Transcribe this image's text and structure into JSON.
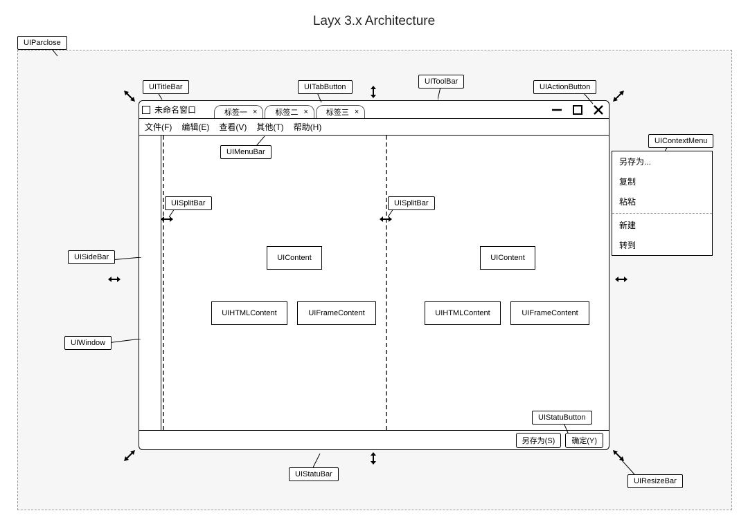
{
  "title": "Layx 3.x Architecture",
  "window_title": "未命名窗口",
  "tabs": [
    "标签一",
    "标签二",
    "标签三"
  ],
  "menu": [
    "文件(F)",
    "编辑(E)",
    "查看(V)",
    "其他(T)",
    "帮助(H)"
  ],
  "status_buttons": [
    "另存为(S)",
    "确定(Y)"
  ],
  "context_menu": {
    "group1": [
      "另存为...",
      "复制",
      "粘粘"
    ],
    "group2": [
      "新建",
      "转到"
    ]
  },
  "tree": {
    "root": "UIContent",
    "left": "UIHTMLContent",
    "right": "UIFrameContent"
  },
  "callouts": {
    "parclose": "UIParclose",
    "titlebar": "UITitleBar",
    "tabbutton": "UITabButton",
    "toolbar": "UIToolBar",
    "actionbutton": "UIActionButton",
    "menubar": "UIMenuBar",
    "splitbar_left": "UISplitBar",
    "splitbar_right": "UISplitBar",
    "sidebar": "UISideBar",
    "window": "UIWindow",
    "contextmenu": "UIContextMenu",
    "statubutton": "UIStatuButton",
    "statubar": "UIStatuBar",
    "resizebar": "UIResizeBar"
  }
}
